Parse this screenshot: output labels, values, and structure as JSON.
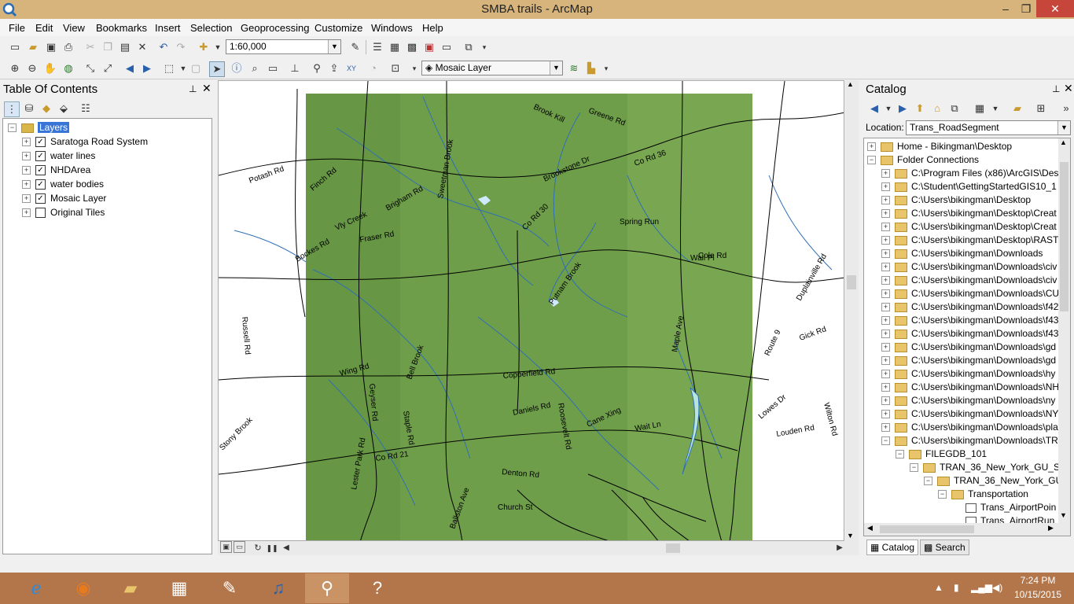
{
  "window": {
    "title": "SMBA trails - ArcMap",
    "minimize": "–",
    "maximize": "❐",
    "close": "✕"
  },
  "menu": [
    "File",
    "Edit",
    "View",
    "Bookmarks",
    "Insert",
    "Selection",
    "Geoprocessing",
    "Customize",
    "Windows",
    "Help"
  ],
  "toolbar": {
    "scale": "1:60,000",
    "target_layer": "Mosaic Layer"
  },
  "toc": {
    "title": "Table Of Contents",
    "root": "Layers",
    "layers": [
      {
        "name": "Saratoga Road System",
        "checked": true
      },
      {
        "name": "water lines",
        "checked": true
      },
      {
        "name": "NHDArea",
        "checked": true
      },
      {
        "name": "water bodies",
        "checked": true
      },
      {
        "name": "Mosaic Layer",
        "checked": true
      },
      {
        "name": "Original Tiles",
        "checked": false
      }
    ]
  },
  "map": {
    "labels": [
      "Greene Rd",
      "Brook Kill",
      "Co Rd 36",
      "Brookstone Dr",
      "Spring Run",
      "Co Rd 30",
      "Fraser Rd",
      "Bockes Rd",
      "Vly Creek",
      "Brigham Rd",
      "Finch Rd",
      "Potash Rd",
      "Putnam Brook",
      "Wing Rd",
      "Bell Brook",
      "Copperfield Rd",
      "Daniels Rd",
      "Cane Xing",
      "Wait Ln",
      "Co Rd 21",
      "Denton Rd",
      "Church St",
      "Roosevelt Rd",
      "Ballston Ave",
      "Staple Rd",
      "Lester Park Rd",
      "Geyser Rd",
      "Maple Ave",
      "Wilton Rd",
      "Louden Rd",
      "Lowes Dr",
      "Duplainville Rd",
      "Russell Rd",
      "Route 9",
      "Stony Brook",
      "Sweetman Brook",
      "Cole Rd",
      "Wall Pl",
      "Gick Rd"
    ]
  },
  "catalog": {
    "title": "Catalog",
    "location_label": "Location:",
    "location_value": "Trans_RoadSegment",
    "items": [
      {
        "label": "Home - Bikingman\\Desktop",
        "level": 0,
        "exp": "+"
      },
      {
        "label": "Folder Connections",
        "level": 0,
        "exp": "-"
      },
      {
        "label": "C:\\Program Files (x86)\\ArcGIS\\Deskt",
        "level": 1,
        "exp": "+"
      },
      {
        "label": "C:\\Student\\GettingStartedGIS10_1",
        "level": 1,
        "exp": "+"
      },
      {
        "label": "C:\\Users\\bikingman\\Desktop",
        "level": 1,
        "exp": "+"
      },
      {
        "label": "C:\\Users\\bikingman\\Desktop\\Creat",
        "level": 1,
        "exp": "+"
      },
      {
        "label": "C:\\Users\\bikingman\\Desktop\\Creat",
        "level": 1,
        "exp": "+"
      },
      {
        "label": "C:\\Users\\bikingman\\Desktop\\RAST",
        "level": 1,
        "exp": "+"
      },
      {
        "label": "C:\\Users\\bikingman\\Downloads",
        "level": 1,
        "exp": "+"
      },
      {
        "label": "C:\\Users\\bikingman\\Downloads\\civ",
        "level": 1,
        "exp": "+"
      },
      {
        "label": "C:\\Users\\bikingman\\Downloads\\civ",
        "level": 1,
        "exp": "+"
      },
      {
        "label": "C:\\Users\\bikingman\\Downloads\\CU",
        "level": 1,
        "exp": "+"
      },
      {
        "label": "C:\\Users\\bikingman\\Downloads\\f42",
        "level": 1,
        "exp": "+"
      },
      {
        "label": "C:\\Users\\bikingman\\Downloads\\f43",
        "level": 1,
        "exp": "+"
      },
      {
        "label": "C:\\Users\\bikingman\\Downloads\\f43",
        "level": 1,
        "exp": "+"
      },
      {
        "label": "C:\\Users\\bikingman\\Downloads\\gd",
        "level": 1,
        "exp": "+"
      },
      {
        "label": "C:\\Users\\bikingman\\Downloads\\gd",
        "level": 1,
        "exp": "+"
      },
      {
        "label": "C:\\Users\\bikingman\\Downloads\\hy",
        "level": 1,
        "exp": "+"
      },
      {
        "label": "C:\\Users\\bikingman\\Downloads\\NH",
        "level": 1,
        "exp": "+"
      },
      {
        "label": "C:\\Users\\bikingman\\Downloads\\ny",
        "level": 1,
        "exp": "+"
      },
      {
        "label": "C:\\Users\\bikingman\\Downloads\\NY",
        "level": 1,
        "exp": "+"
      },
      {
        "label": "C:\\Users\\bikingman\\Downloads\\pla",
        "level": 1,
        "exp": "+"
      },
      {
        "label": "C:\\Users\\bikingman\\Downloads\\TR",
        "level": 1,
        "exp": "-"
      },
      {
        "label": "FILEGDB_101",
        "level": 2,
        "exp": "-"
      },
      {
        "label": "TRAN_36_New_York_GU_STA",
        "level": 3,
        "exp": "-"
      },
      {
        "label": "TRAN_36_New_York_GU_",
        "level": 4,
        "exp": "-"
      },
      {
        "label": "Transportation",
        "level": 5,
        "exp": "-"
      },
      {
        "label": "Trans_AirportPoin",
        "level": 6,
        "exp": ""
      },
      {
        "label": "Trans_AirportRun",
        "level": 6,
        "exp": ""
      }
    ],
    "tabs": [
      "Catalog",
      "Search"
    ]
  },
  "taskbar": {
    "time": "7:24 PM",
    "date": "10/15/2015"
  },
  "colors": {
    "titlebar": "#d7b47c",
    "taskbar": "#b3764a",
    "raster": "#6f9e4a",
    "water": "#2f6fb5"
  }
}
